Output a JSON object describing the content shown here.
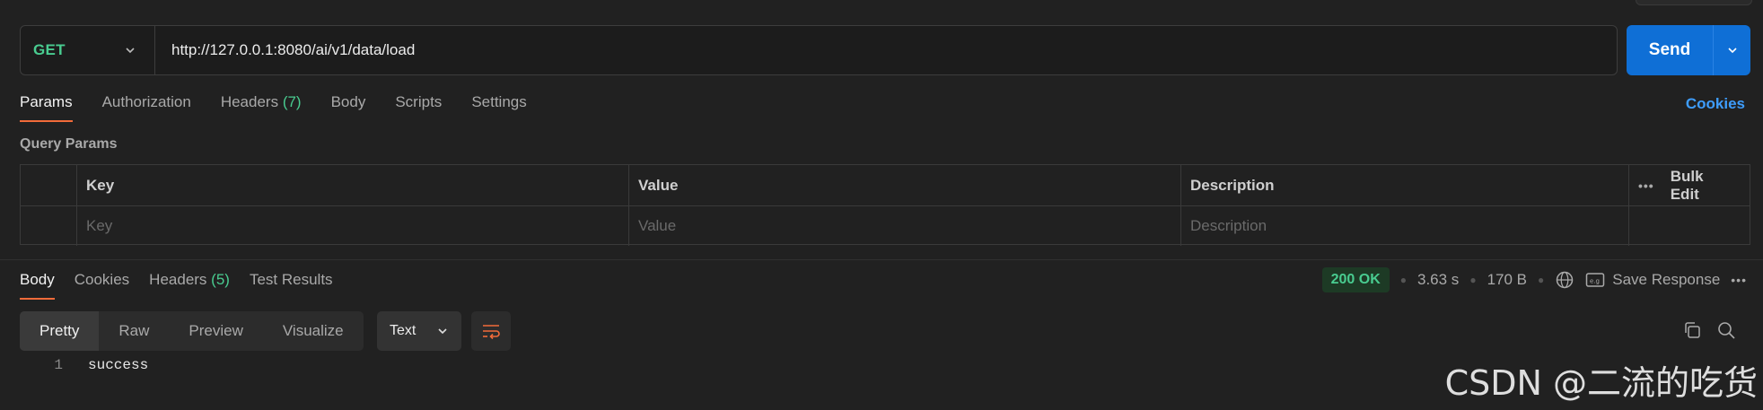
{
  "request": {
    "method": "GET",
    "url": "http://127.0.0.1:8080/ai/v1/data/load",
    "send_label": "Send",
    "tabs": [
      {
        "label": "Params",
        "active": true
      },
      {
        "label": "Authorization"
      },
      {
        "label": "Headers",
        "count": "(7)"
      },
      {
        "label": "Body"
      },
      {
        "label": "Scripts"
      },
      {
        "label": "Settings"
      }
    ],
    "cookies_label": "Cookies"
  },
  "params": {
    "section_title": "Query Params",
    "columns": {
      "key": "Key",
      "value": "Value",
      "description": "Description"
    },
    "bulk_edit": "Bulk Edit",
    "placeholders": {
      "key": "Key",
      "value": "Value",
      "description": "Description"
    }
  },
  "response": {
    "tabs": [
      {
        "label": "Body",
        "active": true
      },
      {
        "label": "Cookies"
      },
      {
        "label": "Headers",
        "count": "(5)"
      },
      {
        "label": "Test Results"
      }
    ],
    "status": "200 OK",
    "time": "3.63 s",
    "size": "170 B",
    "save_label": "Save Response",
    "views": [
      "Pretty",
      "Raw",
      "Preview",
      "Visualize"
    ],
    "format": "Text",
    "lines": [
      {
        "no": "1",
        "text": "success"
      }
    ]
  },
  "watermark": "CSDN @二流的吃货",
  "colors": {
    "accent": "#f26b3a",
    "method_get": "#49cc90",
    "send": "#0f6fd6",
    "link": "#3e9dfd"
  }
}
